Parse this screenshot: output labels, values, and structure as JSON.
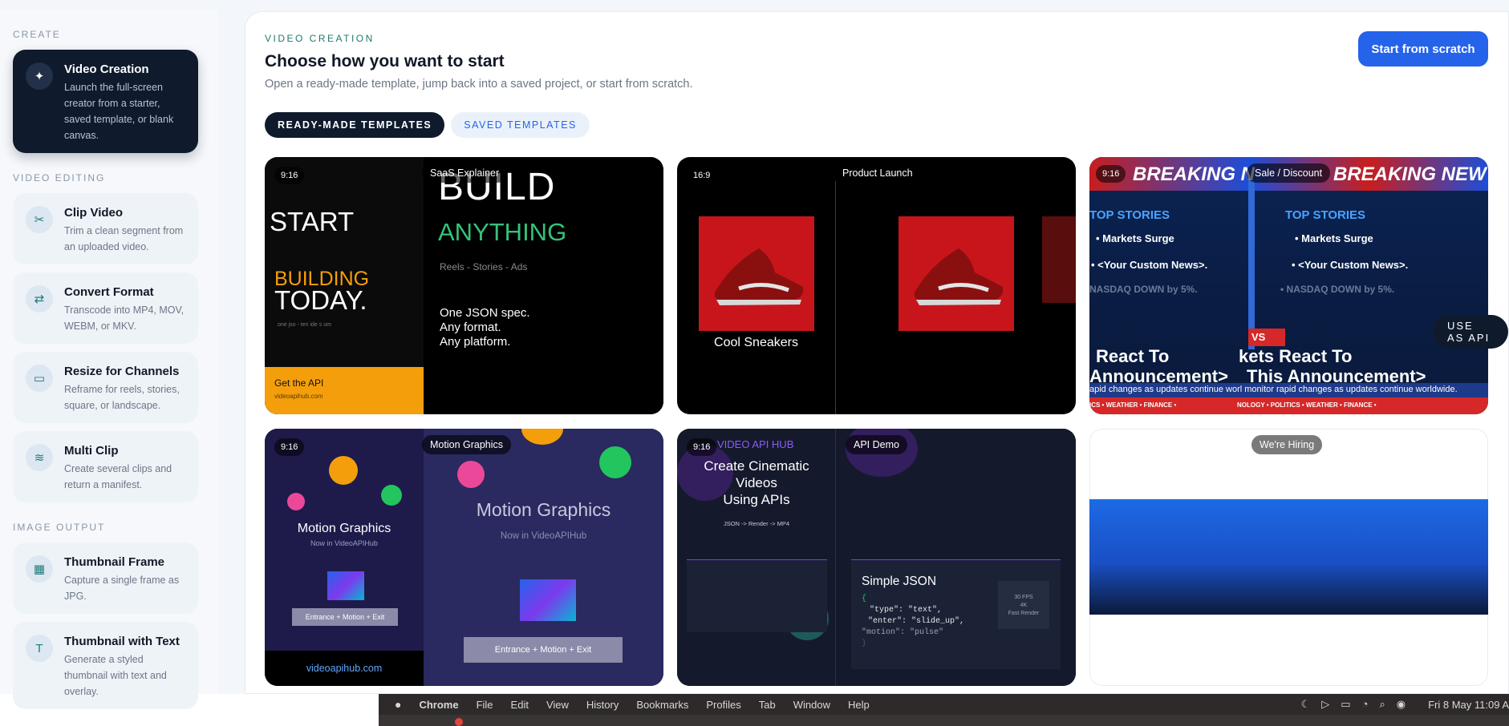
{
  "sidebar": {
    "sections": [
      {
        "label": "CREATE",
        "items": [
          {
            "title": "Video Creation",
            "desc": "Launch the full-screen creator from a starter, saved template, or blank canvas.",
            "icon": "sparkle-icon",
            "active": true
          }
        ]
      },
      {
        "label": "VIDEO EDITING",
        "items": [
          {
            "title": "Clip Video",
            "desc": "Trim a clean segment from an uploaded video.",
            "icon": "scissors-icon"
          },
          {
            "title": "Convert Format",
            "desc": "Transcode into MP4, MOV, WEBM, or MKV.",
            "icon": "arrows-exchange-icon"
          },
          {
            "title": "Resize for Channels",
            "desc": "Reframe for reels, stories, square, or landscape.",
            "icon": "screen-icon"
          },
          {
            "title": "Multi Clip",
            "desc": "Create several clips and return a manifest.",
            "icon": "layers-icon"
          }
        ]
      },
      {
        "label": "IMAGE OUTPUT",
        "items": [
          {
            "title": "Thumbnail Frame",
            "desc": "Capture a single frame as JPG.",
            "icon": "grid-icon"
          },
          {
            "title": "Thumbnail with Text",
            "desc": "Generate a styled thumbnail with text and overlay.",
            "icon": "text-icon"
          }
        ]
      }
    ]
  },
  "header": {
    "kicker": "VIDEO CREATION",
    "title": "Choose how you want to start",
    "subtitle": "Open a ready-made template, jump back into a saved project, or start from scratch.",
    "scratch_button": "Start from scratch"
  },
  "tabs": [
    {
      "label": "READY-MADE TEMPLATES",
      "active": true
    },
    {
      "label": "SAVED TEMPLATES",
      "active": false
    }
  ],
  "cards": {
    "saas": {
      "ratio": "9:16",
      "name": "SaaS Explainer",
      "start": "START",
      "building": "BUILDING",
      "today": "TODAY.",
      "small": "one jso - ten ide s um",
      "get_api": "Get the API",
      "url": "videoapihub.com",
      "build": "BUILD",
      "anything": "ANYTHING",
      "formats": "Reels - Stories - Ads",
      "line1": "One JSON spec.",
      "line2": "Any format.",
      "line3": "Any platform."
    },
    "product": {
      "ratio": "16:9",
      "name": "Product Launch",
      "caption": "Cool Sneakers"
    },
    "sale": {
      "ratio": "9:16",
      "name": "Sale / Discount",
      "breaking": "BREAKING N",
      "breaking2": "BREAKING NEW",
      "top": "TOP STORIES",
      "b1": "• Markets Surge",
      "b2": "• <Your Custom News>.",
      "b3": "NASDAQ DOWN by 5%.",
      "b3b": "• NASDAQ DOWN by 5%.",
      "react1": "React To",
      "react2": "Announcement>",
      "react3": "kets React To",
      "react4": "This Announcement>",
      "ticker": "apid changes as updates continue worl monitor rapid changes as updates continue worldwide.",
      "footer": "ICS • WEATHER • FINANCE •",
      "footer2": "NOLOGY • POLITICS • WEATHER • FINANCE •",
      "ws": "VS",
      "use_api": "USE AS API"
    },
    "motion": {
      "ratio": "9:16",
      "name": "Motion Graphics",
      "title_left": "Motion Graphics",
      "sub_left": "Now in VideoAPIHub",
      "btn_left": "Entrance + Motion + Exit",
      "url": "videoapihub.com",
      "title_right": "Motion Graphics",
      "sub_right": "Now in VideoAPIHub",
      "btn_right": "Entrance + Motion + Exit"
    },
    "api": {
      "ratio": "9:16",
      "name": "API Demo",
      "hub": "VIDEO API HUB",
      "l1": "Create Cinematic",
      "l2": "Videos",
      "l3": "Using APIs",
      "small": "JSON -> Render -> MP4",
      "json_title": "Simple JSON",
      "code1": "{",
      "code2": "\"type\": \"text\",",
      "code3": "\"enter\": \"slide_up\",",
      "code4": "\"motion\": \"pulse\"",
      "code5": "}",
      "spec1": "30 FPS",
      "spec2": "4K",
      "spec3": "Fast Render"
    },
    "hiring": {
      "name": "We're Hiring"
    }
  },
  "macbar": {
    "menus": [
      "Chrome",
      "File",
      "Edit",
      "View",
      "History",
      "Bookmarks",
      "Profiles",
      "Tab",
      "Window",
      "Help"
    ],
    "clock": "Fri 8 May  11:09 A"
  }
}
